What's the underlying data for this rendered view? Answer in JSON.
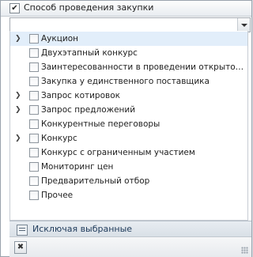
{
  "header": {
    "check_mark": "✔",
    "title": "Способ проведения закупки"
  },
  "combo": {
    "value": ""
  },
  "items": [
    {
      "label": "Аукцион",
      "expandable": true,
      "selected": true
    },
    {
      "label": "Двухэтапный конкурс",
      "expandable": false,
      "selected": false
    },
    {
      "label": "Заинтересованности в проведении открытого конкурса",
      "expandable": false,
      "selected": false
    },
    {
      "label": "Закупка у единственного поставщика",
      "expandable": false,
      "selected": false
    },
    {
      "label": "Запрос котировок",
      "expandable": true,
      "selected": false
    },
    {
      "label": "Запрос предложений",
      "expandable": true,
      "selected": false
    },
    {
      "label": "Конкурентные переговоры",
      "expandable": false,
      "selected": false
    },
    {
      "label": "Конкурс",
      "expandable": true,
      "selected": false
    },
    {
      "label": "Конкурс с ограниченным участием",
      "expandable": false,
      "selected": false
    },
    {
      "label": "Мониторинг цен",
      "expandable": false,
      "selected": false
    },
    {
      "label": "Предварительный отбор",
      "expandable": false,
      "selected": false
    },
    {
      "label": "Прочее",
      "expandable": false,
      "selected": false
    }
  ],
  "footer": {
    "label": "Исключая выбранные",
    "icon": "filter-list-icon"
  },
  "bottom": {
    "close_glyph": "✖",
    "grip_icon": "resize-grip-icon"
  },
  "colors": {
    "selected_row": "#e2eefa",
    "footer_bg": "#dde4ea"
  }
}
